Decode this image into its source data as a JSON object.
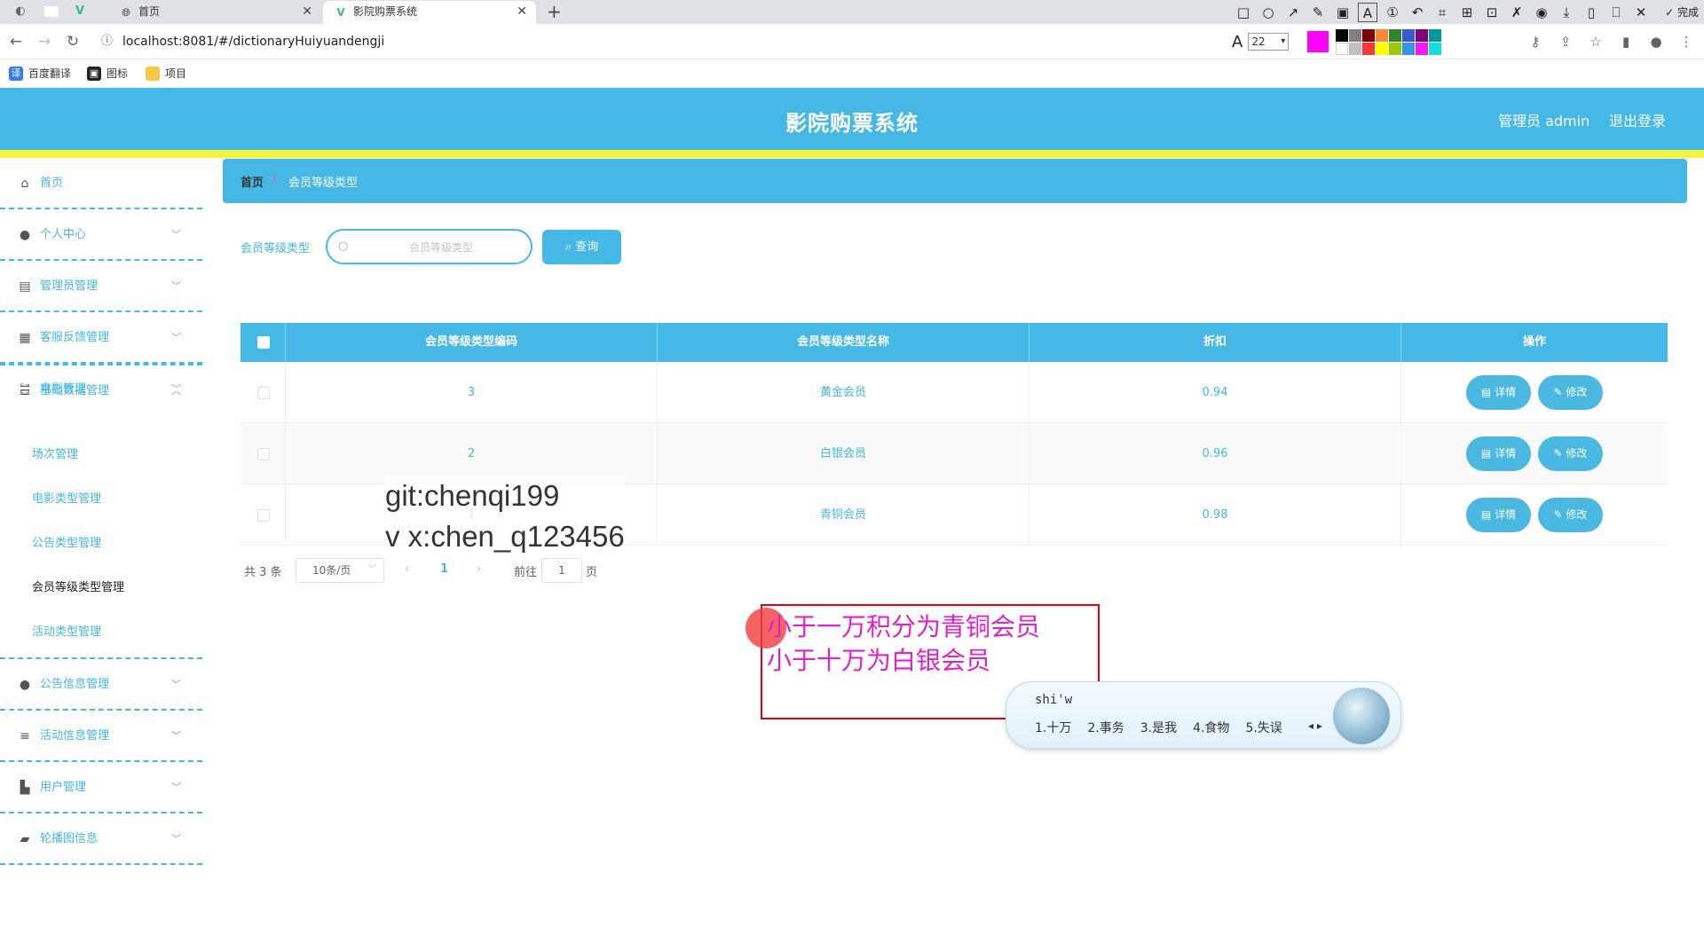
{
  "browser": {
    "tabs": [
      {
        "label": "首页",
        "icon": "globe-icon"
      },
      {
        "label": "影院购票系统",
        "icon": "vue-icon"
      }
    ],
    "url": "localhost:8081/#/dictionaryHuiyuandengji",
    "font_size": "22",
    "done_label": "完成",
    "current_color": "#ff00ff",
    "bookmarks": [
      {
        "label": "百度翻译"
      },
      {
        "label": "图标"
      },
      {
        "label": "项目"
      }
    ]
  },
  "header": {
    "title": "影院购票系统",
    "user": "管理员 admin",
    "logout": "退出登录",
    "accent_color": "#45b8e5"
  },
  "sidebar": {
    "items": [
      {
        "label": "首页",
        "icon": "home-icon"
      },
      {
        "label": "个人中心",
        "icon": "person-icon"
      },
      {
        "label": "管理员管理",
        "icon": "clipboard-icon"
      },
      {
        "label": "客服反馈管理",
        "icon": "grid-icon"
      },
      {
        "label": "电影管理",
        "icon": "fullscreen-icon"
      },
      {
        "label": "基础数据管理",
        "icon": "sliders-icon"
      },
      {
        "label": "公告信息管理",
        "icon": "person-icon"
      },
      {
        "label": "活动信息管理",
        "icon": "list-icon"
      },
      {
        "label": "用户管理",
        "icon": "stamp-icon"
      },
      {
        "label": "轮播图信息",
        "icon": "camera-icon"
      }
    ],
    "sub_items": [
      {
        "label": "场次管理"
      },
      {
        "label": "电影类型管理"
      },
      {
        "label": "公告类型管理"
      },
      {
        "label": "会员等级类型管理"
      },
      {
        "label": "活动类型管理"
      }
    ]
  },
  "breadcrumb": {
    "home": "首页",
    "separator": "/",
    "current": "会员等级类型"
  },
  "search": {
    "label": "会员等级类型",
    "placeholder": "会员等级类型",
    "button": "查询"
  },
  "table": {
    "columns": [
      "会员等级类型编码",
      "会员等级类型名称",
      "折扣",
      "操作"
    ],
    "rows": [
      {
        "code": "3",
        "name": "黄金会员",
        "discount": "0.94"
      },
      {
        "code": "2",
        "name": "白银会员",
        "discount": "0.96"
      },
      {
        "code": "1",
        "name": "青铜会员",
        "discount": "0.98"
      }
    ],
    "detail_label": "详情",
    "edit_label": "修改"
  },
  "pagination": {
    "total": "共 3 条",
    "page_size": "10条/页",
    "current_page": "1",
    "goto_label": "前往",
    "goto_value": "1",
    "page_suffix": "页"
  },
  "overlays": {
    "watermark_line1": "git:chenqi199",
    "watermark_line2": "v x:chen_q123456",
    "annotation_line1": "小于一万积分为青铜会员",
    "annotation_line2": "小于十万为白银会员",
    "ime_pinyin": "shi'w",
    "ime_candidates": [
      "1.十万",
      "2.事务",
      "3.是我",
      "4.食物",
      "5.失误"
    ]
  }
}
